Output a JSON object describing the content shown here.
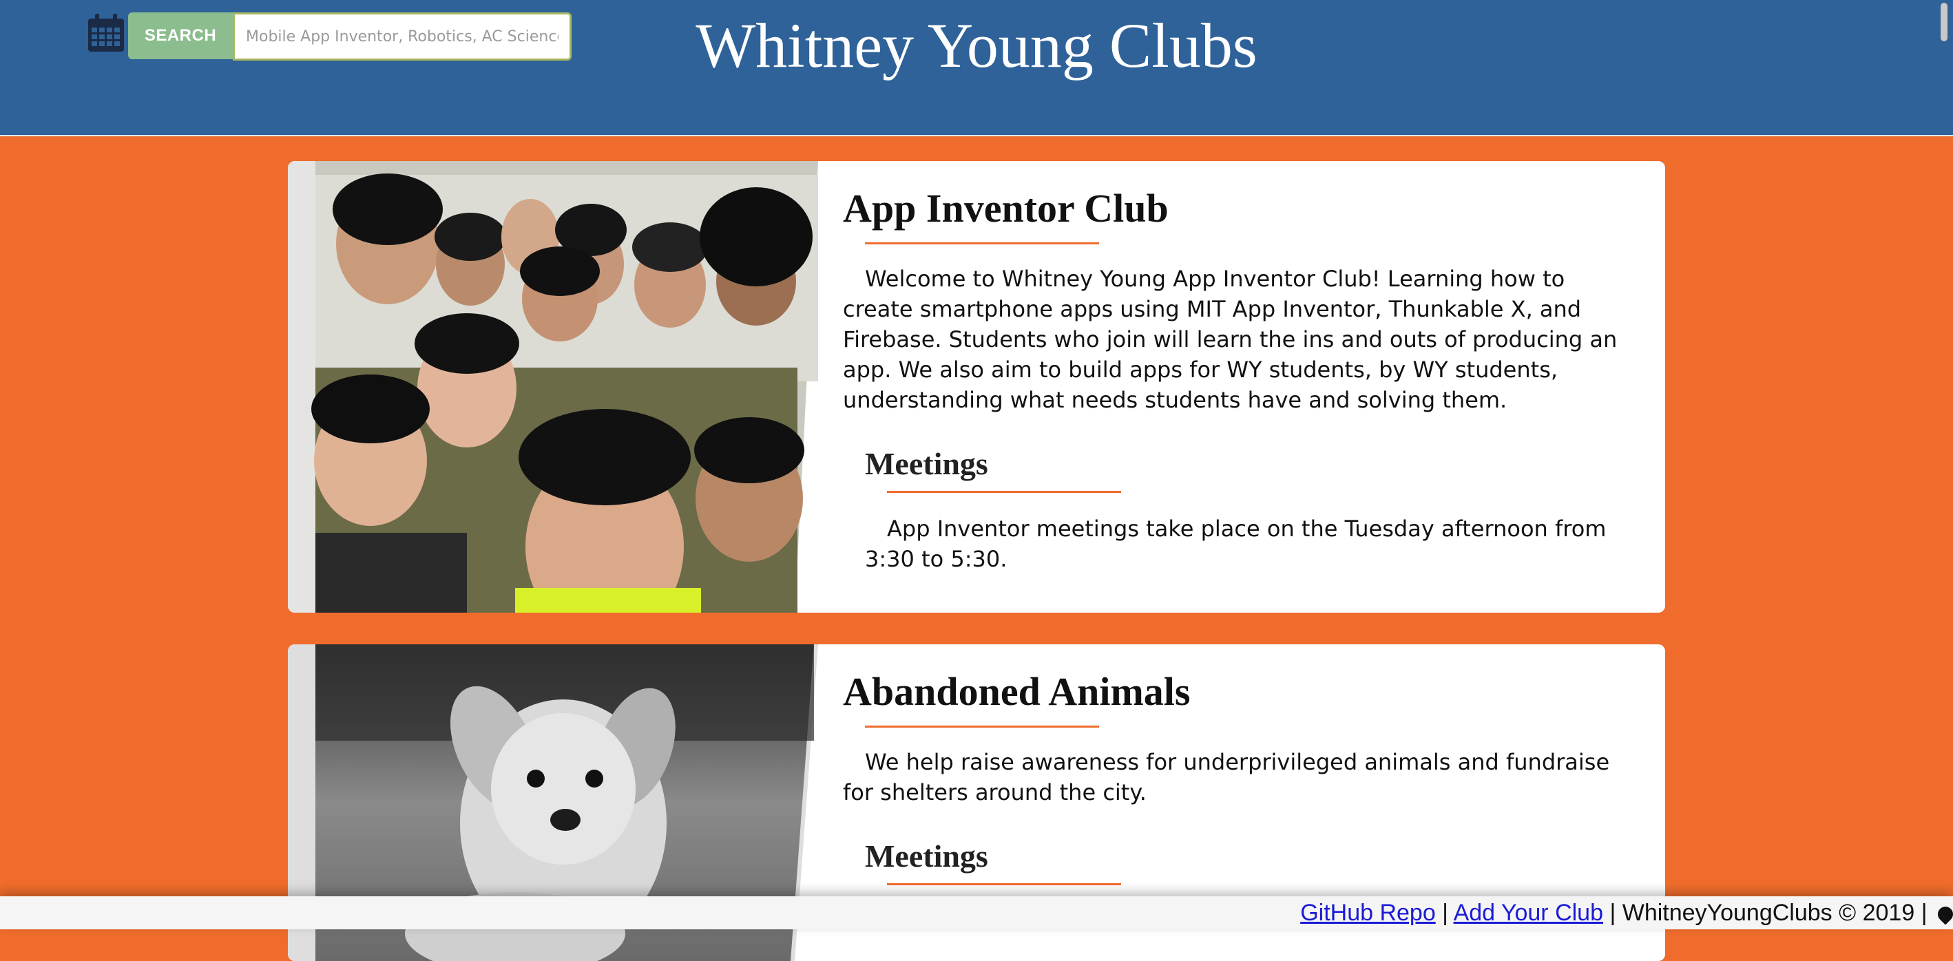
{
  "header": {
    "title": "Whitney Young Clubs",
    "search_button_label": "SEARCH",
    "search_placeholder": "Mobile App Inventor, Robotics, AC Science...",
    "colors": {
      "header_bg": "#2e6299",
      "page_bg": "#ef6c2c",
      "search_button": "#8cbd8e"
    },
    "calendar_icon": "calendar-icon"
  },
  "clubs": [
    {
      "name": "App Inventor Club",
      "description": "Welcome to Whitney Young App Inventor Club! Learning how to create smartphone apps using MIT App Inventor, Thunkable X, and Firebase. Students who join will learn the ins and outs of producing an app. We also aim to build apps for WY students, by WY students, understanding what needs students have and solving them.",
      "meetings_heading": "Meetings",
      "meetings_text": "App Inventor meetings take place on the Tuesday afternoon from 3:30 to 5:30.",
      "photo": "group-selfie-photo"
    },
    {
      "name": "Abandoned Animals",
      "description": "We help raise awareness for underprivileged animals and fundraise for shelters around the city.",
      "meetings_heading": "Meetings",
      "photo": "puppy-photo"
    }
  ],
  "footer": {
    "github_link": "GitHub Repo",
    "sep1": " | ",
    "add_club_link": "Add Your Club",
    "sep2": " | ",
    "copyright": "WhitneyYoungClubs © 2019",
    "sep3": " | "
  }
}
